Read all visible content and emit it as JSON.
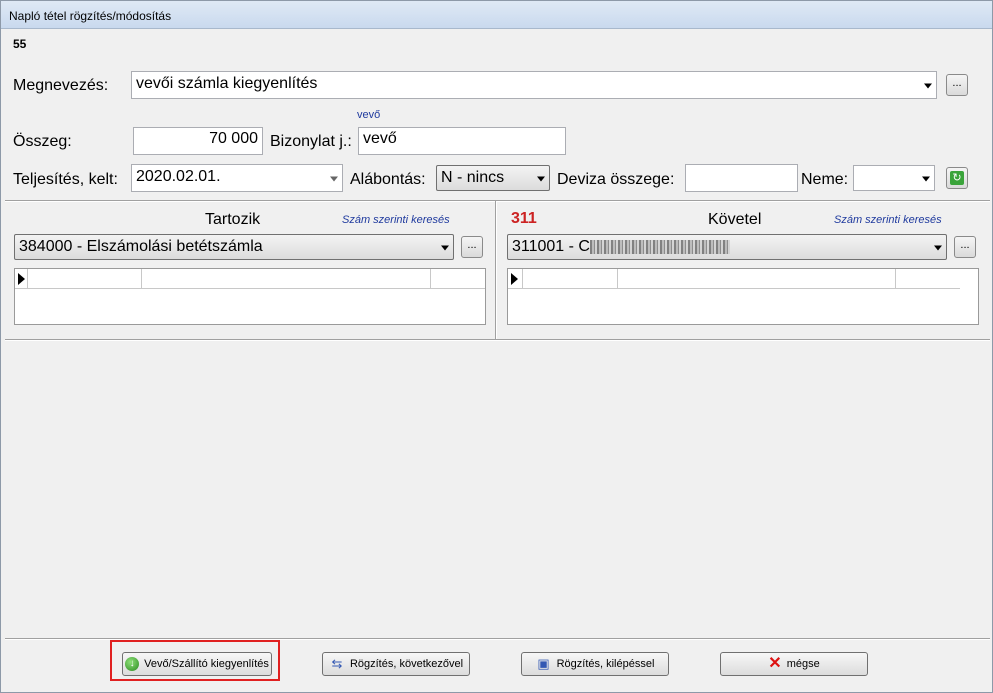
{
  "window": {
    "title": "Napló tétel rögzítés/módosítás",
    "record_number": "55"
  },
  "form": {
    "megnevezes_label": "Megnevezés:",
    "megnevezes_value": "vevői számla kiegyenlítés",
    "more_label": "...",
    "vevo_hint": "vevő",
    "osszeg_label": "Összeg:",
    "osszeg_value": "70 000",
    "bizonylat_label": "Bizonylat j.:",
    "bizonylat_value": "vevő",
    "teljesites_label": "Teljesítés, kelt:",
    "teljesites_value": "2020.02.01.",
    "alabontas_label": "Alábontás:",
    "alabontas_value": "N - nincs",
    "deviza_label": "Deviza összege:",
    "deviza_value": "",
    "neme_label": "Neme:",
    "neme_value": ""
  },
  "tartozik": {
    "heading": "Tartozik",
    "search_link": "Szám szerinti keresés",
    "account": "384000 - Elszámolási betétszámla",
    "more_label": "..."
  },
  "kovetel": {
    "code": "311",
    "heading": "Követel",
    "search_link": "Szám szerinti keresés",
    "account": "311001 - C",
    "more_label": "..."
  },
  "buttons": {
    "vevo_szallito": "Vevő/Szállító kiegyenlítés",
    "rogzites_kovetkezovel": "Rögzítés, következővel",
    "rogzites_kilepessel": "Rögzítés, kilépéssel",
    "megse": "mégse"
  },
  "icons": {
    "vevo_szallito": "green-down-arrow-icon",
    "rogzites_kovetkezovel": "save-next-icon",
    "rogzites_kilepessel": "floppy-disk-icon",
    "megse": "red-x-icon",
    "refresh": "refresh-icon"
  },
  "colors": {
    "highlight": "#e02020",
    "link_blue": "#1f3a9e",
    "code_red": "#cc2222"
  }
}
